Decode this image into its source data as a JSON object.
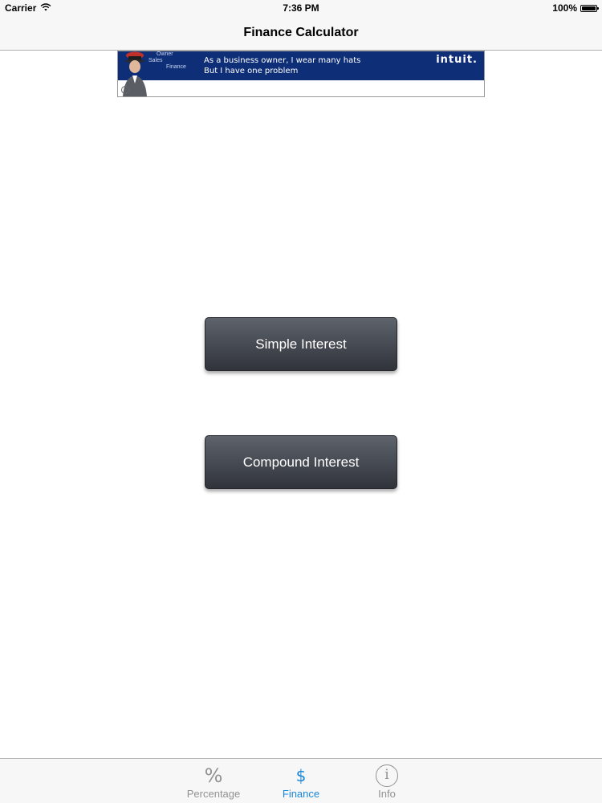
{
  "status_bar": {
    "carrier": "Carrier",
    "time": "7:36 PM",
    "battery": "100%"
  },
  "nav_bar": {
    "title": "Finance Calculator"
  },
  "ad": {
    "hat_labels": [
      "Owner",
      "Sales",
      "Finance"
    ],
    "line1": "As a business owner, I wear many hats",
    "line2": "But I have one problem",
    "logo": "intuit."
  },
  "buttons": {
    "simple": "Simple Interest",
    "compound": "Compound Interest"
  },
  "tabs": [
    {
      "glyph": "%",
      "label": "Percentage",
      "active": false
    },
    {
      "glyph": "$",
      "label": "Finance",
      "active": true
    },
    {
      "glyph": "i",
      "label": "Info",
      "active": false
    }
  ],
  "colors": {
    "tab_active": "#1a86d6",
    "tab_inactive": "#929292",
    "ad_background": "#0e2f78",
    "button_dark": "#3a3e45"
  }
}
